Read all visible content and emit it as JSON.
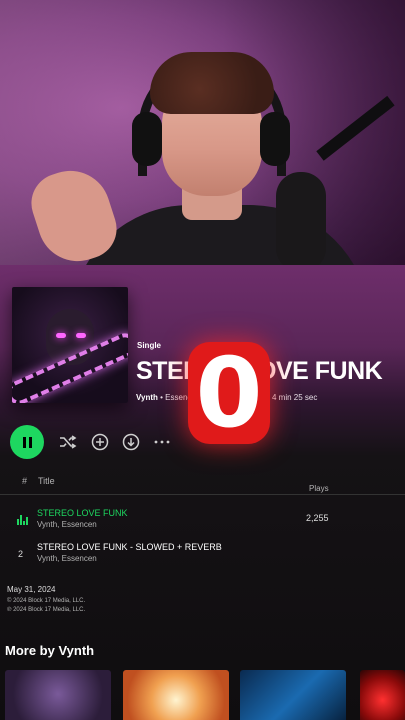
{
  "release": {
    "type_label": "Single",
    "title": "STEREO LOVE FUNK",
    "artist": "Vynth",
    "meta_rest": " • Essencen • 2024",
    "duration": "4 min 25 sec"
  },
  "overlay": {
    "counter": "0"
  },
  "tracks_header": {
    "hash": "#",
    "title": "Title",
    "plays": "Plays"
  },
  "tracks": [
    {
      "number": "1",
      "name": "STEREO LOVE FUNK",
      "artists": "Vynth, Essencen",
      "plays": "2,255",
      "playing": true
    },
    {
      "number": "2",
      "name": "STEREO LOVE FUNK - SLOWED + REVERB",
      "artists": "Vynth, Essencen",
      "plays": "",
      "playing": false
    }
  ],
  "footer": {
    "release_date": "May 31, 2024",
    "copyright_1": "© 2024 Block 17 Media, LLC.",
    "copyright_2": "℗ 2024 Block 17 Media, LLC."
  },
  "more_by": {
    "heading": "More by Vynth"
  },
  "colors": {
    "accent": "#1ed760",
    "overlay_red": "#e01a1a",
    "header_purple": "#6e2e6b"
  },
  "icons": {
    "play": "pause-icon",
    "shuffle": "shuffle-icon",
    "add": "add-circle-icon",
    "download": "download-icon",
    "more": "more-icon",
    "equalizer": "equalizer-icon"
  }
}
